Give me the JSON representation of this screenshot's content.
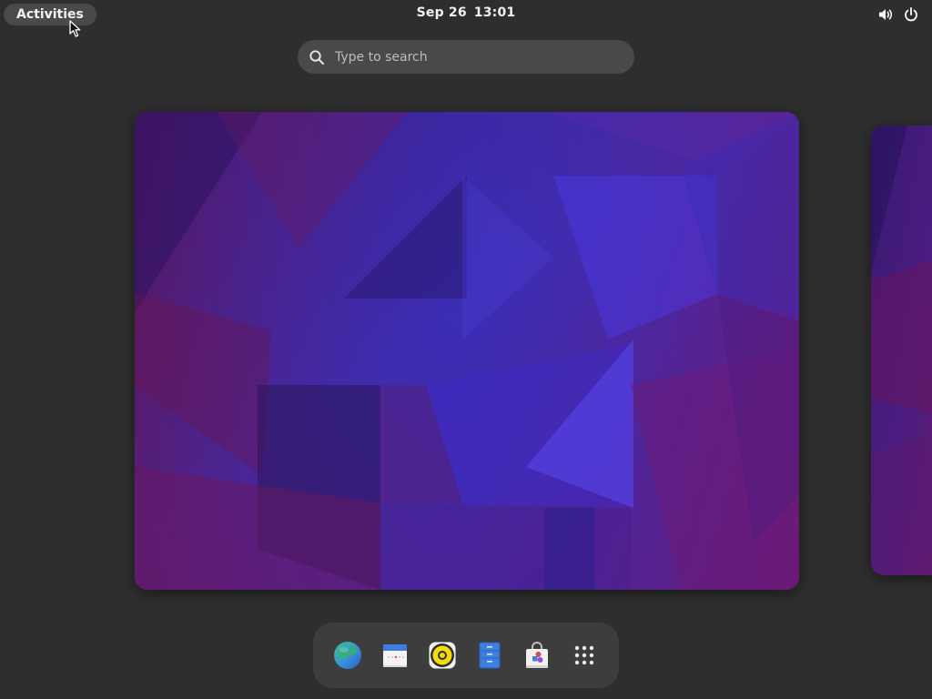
{
  "topbar": {
    "activities_label": "Activities",
    "date": "Sep 26",
    "time": "13:01",
    "tray_icons": [
      "volume-icon",
      "power-icon"
    ]
  },
  "search": {
    "placeholder": "Type to search",
    "value": ""
  },
  "workspaces": [
    {
      "name": "workspace-1",
      "state": "active"
    },
    {
      "name": "workspace-2",
      "state": "adjacent"
    }
  ],
  "dash": {
    "items": [
      {
        "name": "web-browser-icon"
      },
      {
        "name": "calendar-icon"
      },
      {
        "name": "music-player-icon"
      },
      {
        "name": "files-icon"
      },
      {
        "name": "software-store-icon"
      },
      {
        "name": "show-apps-icon"
      }
    ]
  },
  "colors": {
    "background": "#2e2e2e",
    "panel": "#494949",
    "dash": "#3d3d3d",
    "wallpaper_primary": "#4a1fa8",
    "wallpaper_secondary": "#6b1a6a"
  }
}
